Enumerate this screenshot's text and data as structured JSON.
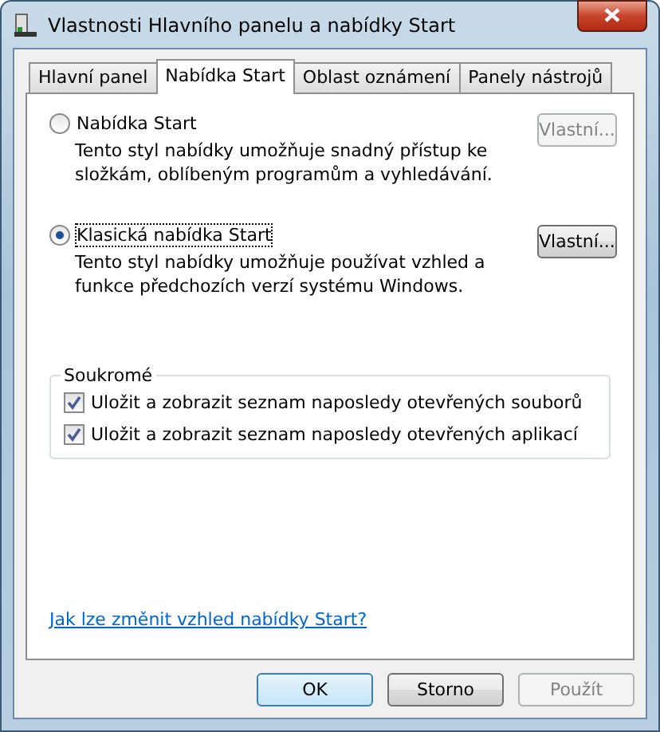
{
  "window": {
    "title": "Vlastnosti Hlavního panelu a nabídky Start"
  },
  "tabs": [
    {
      "label": "Hlavní panel",
      "selected": false
    },
    {
      "label": "Nabídka Start",
      "selected": true
    },
    {
      "label": "Oblast oznámení",
      "selected": false
    },
    {
      "label": "Panely nástrojů",
      "selected": false
    }
  ],
  "options": [
    {
      "label": "Nabídka Start",
      "selected": false,
      "description": "Tento styl nabídky umožňuje snadný přístup ke složkám, oblíbeným programům a vyhledávání.",
      "button": {
        "label": "Vlastní...",
        "disabled": true
      }
    },
    {
      "label": "Klasická nabídka Start",
      "selected": true,
      "description": "Tento styl nabídky umožňuje používat vzhled a funkce předchozích verzí systému Windows.",
      "button": {
        "label": "Vlastní...",
        "disabled": false
      }
    }
  ],
  "privacy": {
    "title": "Soukromé",
    "items": [
      {
        "label": "Uložit a zobrazit seznam naposledy otevřených souborů",
        "checked": true
      },
      {
        "label": "Uložit a zobrazit seznam naposledy otevřených aplikací",
        "checked": true
      }
    ]
  },
  "help_link": "Jak lze změnit vzhled nabídky Start?",
  "buttons": [
    {
      "label": "OK",
      "disabled": false,
      "default": true
    },
    {
      "label": "Storno",
      "disabled": false,
      "default": false
    },
    {
      "label": "Použít",
      "disabled": true,
      "default": false
    }
  ]
}
